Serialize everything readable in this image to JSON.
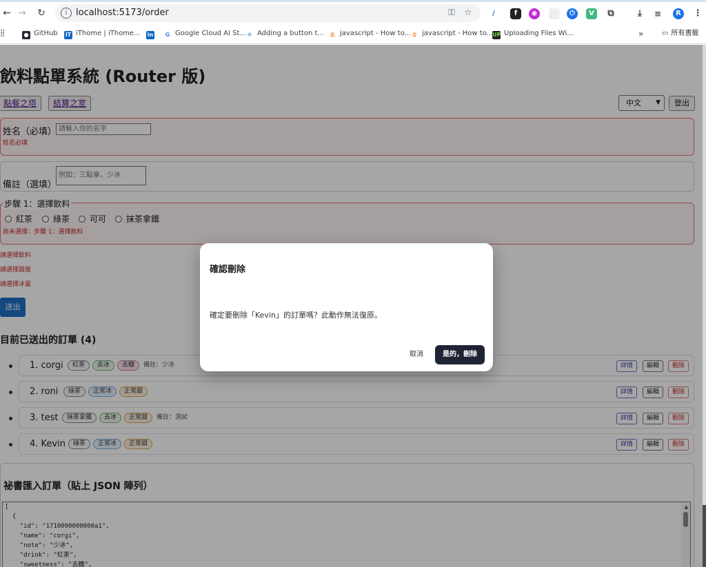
{
  "browser": {
    "url": "localhost:5173/order",
    "bookmarks": [
      {
        "label": "GitHub",
        "icon": "github-icon",
        "color": "#24292f"
      },
      {
        "label": "iThome | iThome...",
        "icon": "ithome-icon",
        "color": "#1565c0"
      },
      {
        "label": "",
        "icon": "linkedin-icon",
        "color": "#0a66c2"
      },
      {
        "label": "Google Cloud AI St...",
        "icon": "google-icon",
        "color": "#4285f4"
      },
      {
        "label": "Adding a button t...",
        "icon": "puzzle-icon",
        "color": "#4a90d9"
      },
      {
        "label": "javascript - How to...",
        "icon": "stackoverflow-icon",
        "color": "#f48024"
      },
      {
        "label": "javascript - How to...",
        "icon": "stackoverflow-icon",
        "color": "#f48024"
      },
      {
        "label": "Uploading Files Wi...",
        "icon": "upwork-icon",
        "color": "#222222"
      }
    ],
    "overflow": "»",
    "all_bookmarks": "所有書籤",
    "profile_initial": "R"
  },
  "app": {
    "title": "飲料點單系統 (Router 版)",
    "nav": {
      "order": "點餐之塔",
      "checkout": "結算之室"
    },
    "lang_selected": "中文",
    "logout": "登出"
  },
  "form": {
    "name_label": "姓名（必填）",
    "name_placeholder": "請輸入你的名字",
    "name_error": "姓名必填",
    "note_label": "備註（選填）",
    "note_placeholder": "例如：三點拿、少冰",
    "step1_legend": "步驟 1：選擇飲料",
    "drinks": [
      "紅茶",
      "綠茶",
      "可可",
      "抹茶拿鐵"
    ],
    "step1_error": "尚未選擇：步驟 1：選擇飲料",
    "errors": [
      "請選擇飲料",
      "請選擇甜度",
      "請選擇冰量"
    ],
    "submit": "送出"
  },
  "orders": {
    "heading": "目前已送出的訂單 (4)",
    "actions": {
      "detail": "詳情",
      "edit": "編輯",
      "delete": "刪除"
    },
    "items": [
      {
        "name": "1. corgi",
        "tags": [
          {
            "text": "紅茶",
            "kind": "drink"
          },
          {
            "text": "去冰",
            "kind": "ice2"
          },
          {
            "text": "去糖",
            "kind": "sweet2"
          }
        ],
        "note": "備註：少冰"
      },
      {
        "name": "2. roni",
        "tags": [
          {
            "text": "綠茶",
            "kind": "drink"
          },
          {
            "text": "正常冰",
            "kind": "ice"
          },
          {
            "text": "正常甜",
            "kind": "sweet"
          }
        ],
        "note": ""
      },
      {
        "name": "3. test",
        "tags": [
          {
            "text": "抹茶拿鐵",
            "kind": "drink"
          },
          {
            "text": "去冰",
            "kind": "ice2"
          },
          {
            "text": "正常甜",
            "kind": "sweet"
          }
        ],
        "note": "備註：測試"
      },
      {
        "name": "4. Kevin",
        "tags": [
          {
            "text": "綠茶",
            "kind": "drink"
          },
          {
            "text": "正常冰",
            "kind": "ice"
          },
          {
            "text": "正常甜",
            "kind": "sweet"
          }
        ],
        "note": ""
      }
    ]
  },
  "import": {
    "title": "祕書匯入訂單（貼上 JSON 陣列）",
    "lines": [
      "[",
      "  {",
      "    \"id\": \"1710000000000a1\",",
      "    \"name\": \"corgi\",",
      "    \"note\": \"少冰\",",
      "    \"drink\": \"紅茶\",",
      "    \"sweetness\": \"去糖\","
    ]
  },
  "modal": {
    "title": "確認刪除",
    "body": "確定要刪除「Kevin」的訂單嗎？此動作無法復原。",
    "cancel": "取消",
    "confirm": "是的，刪除"
  }
}
